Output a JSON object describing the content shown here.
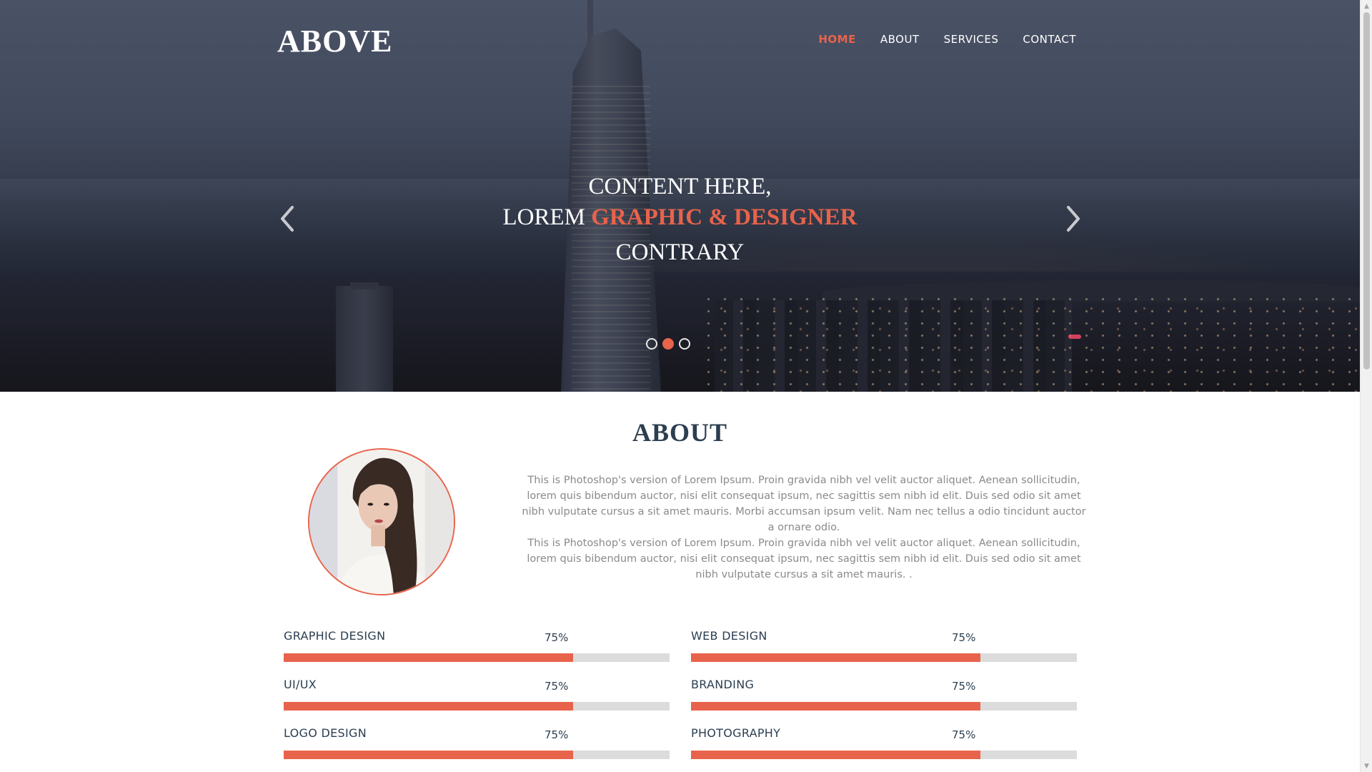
{
  "header": {
    "logo": "ABOVE",
    "nav": [
      {
        "label": "HOME",
        "active": true
      },
      {
        "label": "ABOUT",
        "active": false
      },
      {
        "label": "SERVICES",
        "active": false
      },
      {
        "label": "CONTACT",
        "active": false
      }
    ]
  },
  "hero": {
    "line1": "CONTENT HERE,",
    "line2_prefix": "LOREM ",
    "line2_accent": "GRAPHIC & DESIGNER",
    "line3": "CONTRARY",
    "arrows": {
      "prev_icon": "chevron-left-icon",
      "next_icon": "chevron-right-icon"
    },
    "slides": 3,
    "active_slide": 2
  },
  "about": {
    "title": "ABOUT",
    "paragraph1": "This is Photoshop's version of Lorem Ipsum. Proin gravida nibh vel velit auctor aliquet. Aenean sollicitudin, lorem quis bibendum auctor, nisi elit consequat ipsum, nec sagittis sem nibh id elit. Duis sed odio sit amet nibh vulputate cursus a sit amet mauris. Morbi accumsan ipsum velit. Nam nec tellus a odio tincidunt auctor a ornare odio.",
    "paragraph2": "This is Photoshop's version of Lorem Ipsum. Proin gravida nibh vel velit auctor aliquet. Aenean sollicitudin, lorem quis bibendum auctor, nisi elit consequat ipsum, nec sagittis sem nibh id elit. Duis sed odio sit amet nibh vulputate cursus a sit amet mauris. ."
  },
  "skills": [
    {
      "label": "GRAPHIC DESIGN",
      "percent_label": "75%",
      "value": 0.75
    },
    {
      "label": "WEB DESIGN",
      "percent_label": "75%",
      "value": 0.75
    },
    {
      "label": "UI/UX",
      "percent_label": "75%",
      "value": 0.75
    },
    {
      "label": "BRANDING",
      "percent_label": "75%",
      "value": 0.75
    },
    {
      "label": "LOGO DESIGN",
      "percent_label": "75%",
      "value": 0.75
    },
    {
      "label": "PHOTOGRAPHY",
      "percent_label": "75%",
      "value": 0.75
    }
  ],
  "colors": {
    "accent": "#e8634b",
    "heading": "#2c3e50",
    "body_text": "#8a8a8a",
    "track": "#dcdcdc"
  }
}
